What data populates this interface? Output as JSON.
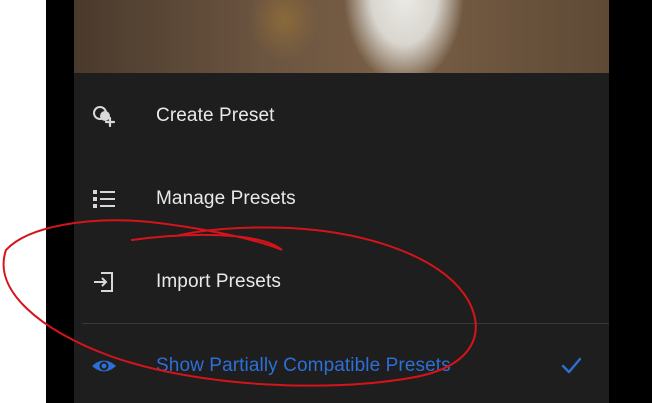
{
  "menu": {
    "items": [
      {
        "label": "Create Preset",
        "icon": "create-preset-icon"
      },
      {
        "label": "Manage Presets",
        "icon": "list-icon"
      },
      {
        "label": "Import Presets",
        "icon": "import-icon"
      },
      {
        "label": "Show Partially Compatible Presets",
        "icon": "eye-icon",
        "checked": true
      }
    ]
  },
  "colors": {
    "accent": "#2d6fd6",
    "annotation": "#d4141a",
    "sheet_bg": "#1e1e1e"
  }
}
